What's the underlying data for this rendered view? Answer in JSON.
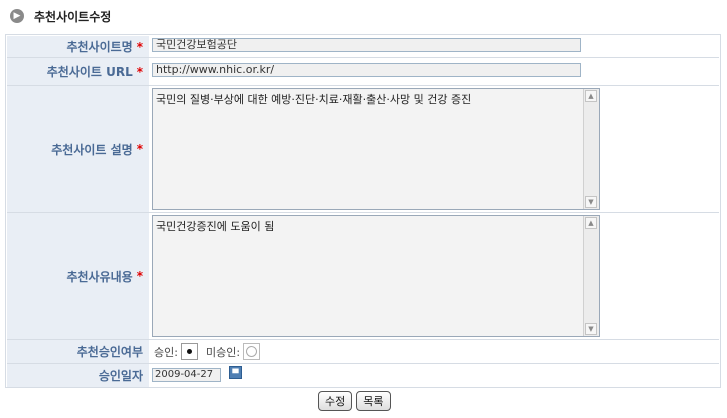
{
  "page": {
    "title": "추천사이트수정"
  },
  "form": {
    "site_name": {
      "label": "추천사이트명",
      "value": "국민건강보험공단"
    },
    "site_url": {
      "label": "추천사이트 URL",
      "value": "http://www.nhic.or.kr/"
    },
    "site_description": {
      "label": "추천사이트 설명",
      "value": "국민의 질병·부상에 대한 예방·진단·치료·재활·출산·사망 및 건강 증진"
    },
    "reason": {
      "label": "추천사유내용",
      "value": "국민건강증진에 도움이 됨"
    },
    "approval": {
      "label": "추천승인여부",
      "approved_label": "승인:",
      "unapproved_label": "미승인:",
      "selected": "승인"
    },
    "approval_date": {
      "label": "승인일자",
      "value": "2009-04-27"
    },
    "required_mark": "*"
  },
  "buttons": {
    "edit": "수정",
    "list": "목록"
  },
  "icons": {
    "title": "chevron-right-circle-icon",
    "calendar": "calendar-icon",
    "scroll_up": "scroll-up-icon",
    "scroll_down": "scroll-down-icon"
  }
}
